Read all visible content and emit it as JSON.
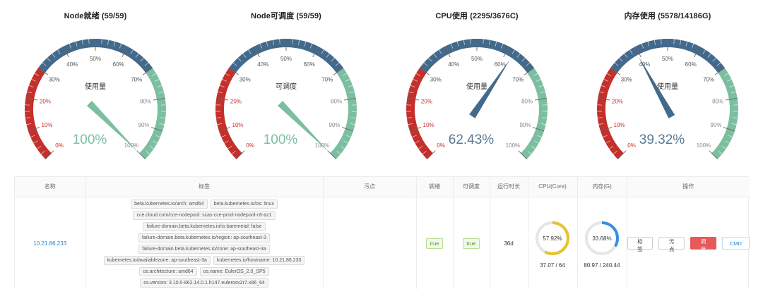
{
  "gauges": [
    {
      "title": "Node就绪 (59/59)",
      "center_label": "使用量",
      "value_text": "100%",
      "percent": 100,
      "value_color": "#7cbfa0"
    },
    {
      "title": "Node可调度 (59/59)",
      "center_label": "可调度",
      "value_text": "100%",
      "percent": 100,
      "value_color": "#7cbfa0"
    },
    {
      "title": "CPU使用 (2295/3676C)",
      "center_label": "使用量",
      "value_text": "62.43%",
      "percent": 62.43,
      "value_color": "#5a7a96"
    },
    {
      "title": "内存使用 (5578/14186G)",
      "center_label": "使用量",
      "value_text": "39.32%",
      "percent": 39.32,
      "value_color": "#5a7a96"
    }
  ],
  "gauge_ticks": [
    "0%",
    "10%",
    "20%",
    "30%",
    "40%",
    "50%",
    "60%",
    "70%",
    "80%",
    "90%",
    "100%"
  ],
  "gauge_colors": {
    "red": "#c4302b",
    "blue": "#43698b",
    "green": "#7cbfa0",
    "pointer_green": "#7cbfa0",
    "pointer_blue": "#43698b"
  },
  "table": {
    "headers": [
      "名称",
      "标签",
      "污点",
      "就绪",
      "可调度",
      "运行时长",
      "CPU(Core)",
      "内存(G)",
      "操作"
    ],
    "row": {
      "name": "10.21.86.233",
      "tags": [
        [
          "beta.kubernetes.io/arch: amd64",
          "beta.kubernetes.io/os: linux"
        ],
        [
          "cce.cloud.com/cce-nodepool: scas-cce-prod-nodepool-c6-az1"
        ],
        [
          "failure-domain.beta.kubernetes.io/is-baremetal: false"
        ],
        [
          "failure-domain.beta.kubernetes.io/region: ap-southeast-3"
        ],
        [
          "failure-domain.beta.kubernetes.io/zone: ap-southeast-3a"
        ],
        [
          "kubernetes.io/availablezone: ap-southeast-3a",
          "kubernetes.io/hostname: 10.21.86.233"
        ],
        [
          "os.architecture: amd64",
          "os.name: EulerOS_2.0_SP5"
        ],
        [
          "os.version: 3.10.0-862.14.0.1.h147.eulerosv2r7.x86_64"
        ]
      ],
      "taints": "",
      "ready": "true",
      "schedulable": "true",
      "uptime": "36d",
      "cpu": {
        "percent_text": "57.92%",
        "percent": 57.92,
        "usage": "37.07 / 64",
        "color": "#e8c22e"
      },
      "memory": {
        "percent_text": "33.68%",
        "percent": 33.68,
        "usage": "80.97 / 240.44",
        "color": "#3a8ee6"
      },
      "actions": [
        "标签",
        "污点",
        "调度",
        "CMD"
      ]
    }
  }
}
